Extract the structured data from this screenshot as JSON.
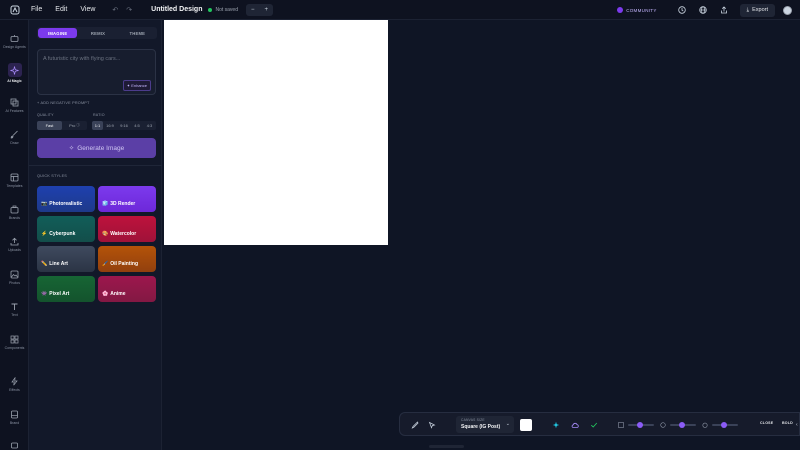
{
  "topbar": {
    "menu": [
      "File",
      "Edit",
      "View"
    ],
    "title": "Untitled Design",
    "status": "Not saved",
    "zoom_minus": "−",
    "zoom_plus": "+",
    "community": "COMMUNITY",
    "export": "Export"
  },
  "rail": {
    "items": [
      {
        "label": "Design Agents",
        "icon": "robot-icon"
      },
      {
        "label": "AI Magic",
        "icon": "sparkle-icon"
      },
      {
        "label": "AI Features",
        "icon": "layers-icon"
      },
      {
        "label": "Draw",
        "icon": "brush-icon"
      },
      {
        "label": "Templates",
        "icon": "template-icon"
      },
      {
        "label": "Brands",
        "icon": "briefcase-icon"
      },
      {
        "label": "Uploads",
        "icon": "upload-icon"
      },
      {
        "label": "Photos",
        "icon": "image-icon"
      },
      {
        "label": "Text",
        "icon": "text-icon"
      },
      {
        "label": "Components",
        "icon": "grid-icon"
      },
      {
        "label": "Effects",
        "icon": "bolt-icon"
      },
      {
        "label": "Brand",
        "icon": "brand-icon"
      }
    ]
  },
  "panel": {
    "tabs": [
      "IMAGINE",
      "REMIX",
      "THEME"
    ],
    "prompt_placeholder": "A futuristic city with flying cars...",
    "enhance": "Enhance",
    "negative_prompt": "ADD NEGATIVE PROMPT",
    "quality_label": "QUALITY",
    "quality_options": [
      "Fast",
      "Pro"
    ],
    "ratio_label": "RATIO",
    "ratio_options": [
      "1:1",
      "16:9",
      "9:16",
      "4:5",
      "4:3"
    ],
    "generate": "Generate Image",
    "quick_styles_label": "QUICK STYLES",
    "styles": [
      {
        "label": "Photorealistic",
        "icon": "📷",
        "color": "#1e3a8a"
      },
      {
        "label": "3D Render",
        "icon": "🧊",
        "color": "#6d28d9"
      },
      {
        "label": "Cyberpunk",
        "icon": "⚡",
        "color": "#0f5c55"
      },
      {
        "label": "Watercolor",
        "icon": "🎨",
        "color": "#9f1239"
      },
      {
        "label": "Line Art",
        "icon": "✏️",
        "color": "#334155"
      },
      {
        "label": "Oil Painting",
        "icon": "🖌️",
        "color": "#92400e"
      },
      {
        "label": "Pixel Art",
        "icon": "👾",
        "color": "#14532d"
      },
      {
        "label": "Anime",
        "icon": "🌸",
        "color": "#831843"
      }
    ]
  },
  "bottombar": {
    "canvas_size_label": "CANVAS SIZE",
    "canvas_size_value": "Square (IG Post)",
    "close": "CLOSE",
    "bold": "BOLD"
  },
  "colors": {
    "accent": "#7c3aed",
    "canvas": "#ffffff",
    "background": "#0f1525"
  }
}
